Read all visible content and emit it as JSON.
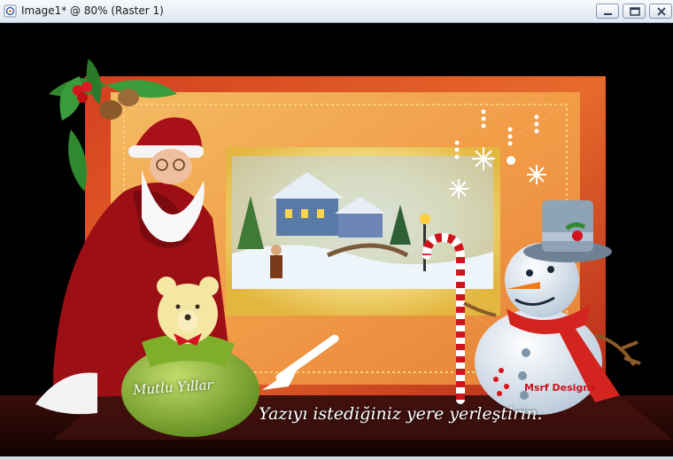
{
  "window": {
    "title": "Image1* @  80% (Raster 1)",
    "buttons": [
      "minimize",
      "maximize",
      "close"
    ]
  },
  "image": {
    "tag_text": "Mutlu Yıllar",
    "instruction_text": "Yazıyı istediğiniz yere yerleştirin.",
    "watermark": "Msrf Designs"
  },
  "colors": {
    "frame_red": "#c6341c",
    "frame_orange": "#f08a3c",
    "inner_gold": "#f3d36a",
    "snowman_scarf": "#d42420",
    "sack_green": "#8ab52e"
  }
}
